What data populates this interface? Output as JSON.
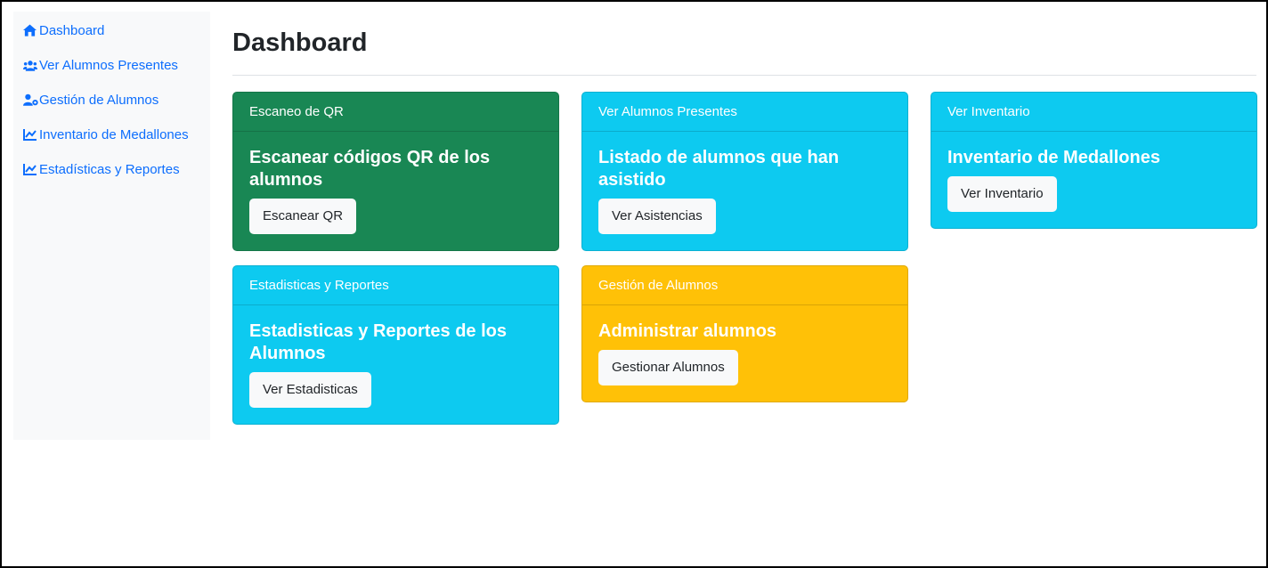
{
  "sidebar": {
    "items": [
      {
        "label": "Dashboard",
        "icon": "home-icon"
      },
      {
        "label": "Ver Alumnos Presentes",
        "icon": "users-icon"
      },
      {
        "label": "Gestión de Alumnos",
        "icon": "user-gear-icon"
      },
      {
        "label": "Inventario de Medallones",
        "icon": "chart-line-icon"
      },
      {
        "label": "Estadísticas y Reportes",
        "icon": "chart-line-icon"
      }
    ]
  },
  "main": {
    "title": "Dashboard",
    "cards": [
      {
        "header": "Escaneo de QR",
        "title": "Escanear códigos QR de los alumnos",
        "button": "Escanear QR",
        "color": "#198754"
      },
      {
        "header": "Ver Alumnos Presentes",
        "title": "Listado de alumnos que han asistido",
        "button": "Ver Asistencias",
        "color": "#0dcaf0"
      },
      {
        "header": "Ver Inventario",
        "title": "Inventario de Medallones",
        "button": "Ver Inventario",
        "color": "#0dcaf0"
      },
      {
        "header": "Estadisticas y Reportes",
        "title": "Estadisticas y Reportes de los Alumnos",
        "button": "Ver Estadisticas",
        "color": "#0dcaf0"
      },
      {
        "header": "Gestión de Alumnos",
        "title": "Administrar alumnos",
        "button": "Gestionar Alumnos",
        "color": "#ffc107"
      }
    ]
  },
  "colors": {
    "link": "#0d6efd",
    "sidebar_bg": "#f8f9fa",
    "success": "#198754",
    "info": "#0dcaf0",
    "warning": "#ffc107"
  }
}
